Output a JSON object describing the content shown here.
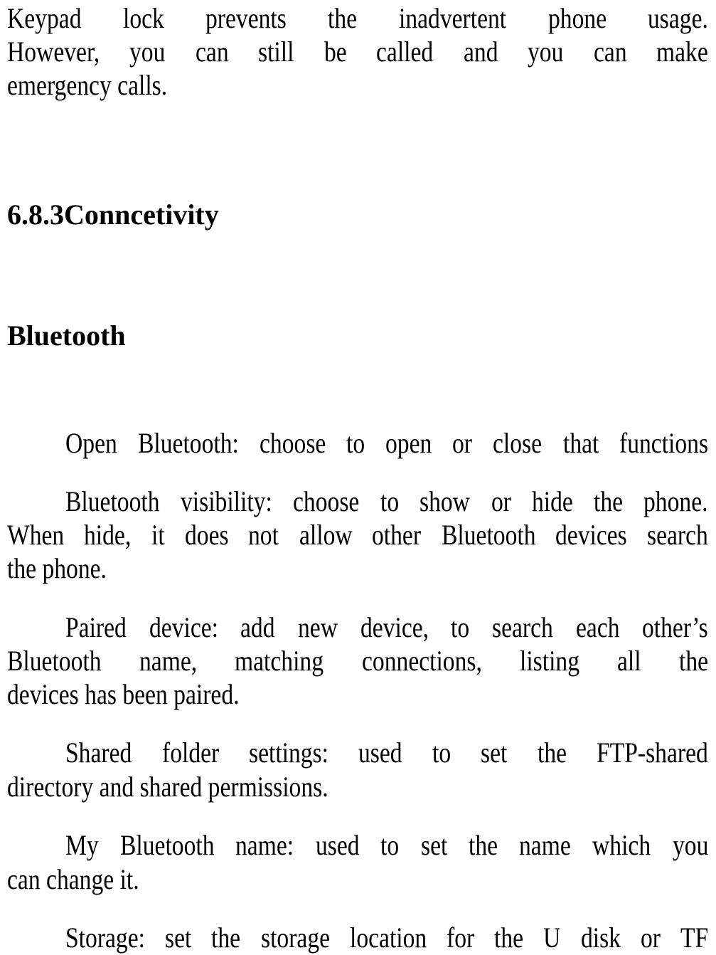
{
  "intro": {
    "lines": [
      "Keypad lock prevents the inadvertent phone usage.",
      "However, you can still be called and you can make",
      "emergency calls."
    ]
  },
  "section_heading": "6.8.3Conncetivity",
  "subsection_heading": "Bluetooth",
  "paragraphs": [
    {
      "name": "open-bluetooth",
      "lines": [
        "Open Bluetooth: choose to open or close that functions"
      ]
    },
    {
      "name": "bluetooth-visibility",
      "lines": [
        "Bluetooth visibility: choose to show or hide the phone.",
        "When hide, it does not allow other Bluetooth devices search",
        "the phone."
      ]
    },
    {
      "name": "paired-device",
      "lines": [
        "Paired device: add new device, to search each other’s",
        "Bluetooth name, matching connections, listing all the",
        "devices has been paired."
      ]
    },
    {
      "name": "shared-folder-settings",
      "lines": [
        "Shared folder settings: used to set the FTP-shared",
        "directory and shared permissions."
      ]
    },
    {
      "name": "my-bluetooth-name",
      "lines": [
        "My Bluetooth name: used to set the name which you",
        "can change it."
      ]
    },
    {
      "name": "storage",
      "lines": [
        "Storage: set the storage location for the U disk or TF"
      ]
    }
  ]
}
